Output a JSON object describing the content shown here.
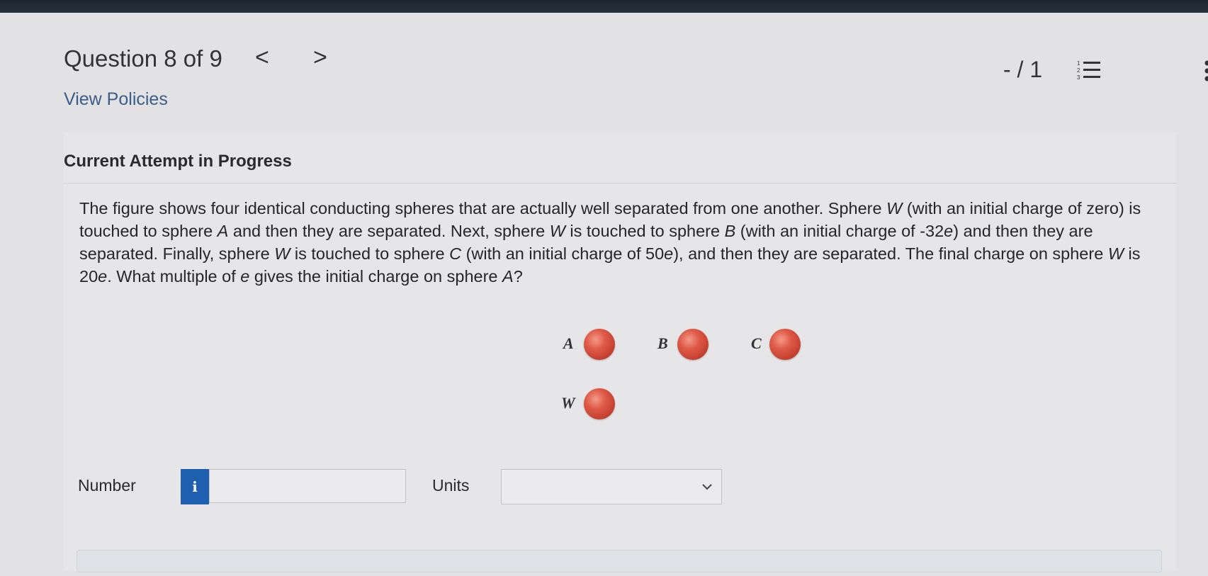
{
  "header": {
    "title": "Question 8 of 9",
    "prev_arrow": "<",
    "next_arrow": ">",
    "score": "- / 1",
    "list_icon": "numbered-list-icon",
    "more_icon": "vertical-ellipsis-icon"
  },
  "policies_link": "View Policies",
  "attempt_heading": "Current Attempt in Progress",
  "question": {
    "parts": [
      {
        "t": "The figure shows four identical conducting spheres that are actually well separated from one another. Sphere ",
        "i": false
      },
      {
        "t": "W",
        "i": true
      },
      {
        "t": " (with an initial charge of zero) is touched to sphere ",
        "i": false
      },
      {
        "t": "A",
        "i": true
      },
      {
        "t": " and then they are separated. Next, sphere ",
        "i": false
      },
      {
        "t": "W",
        "i": true
      },
      {
        "t": " is touched to sphere ",
        "i": false
      },
      {
        "t": "B",
        "i": true
      },
      {
        "t": " (with an initial charge of -32",
        "i": false
      },
      {
        "t": "e",
        "i": true
      },
      {
        "t": ") and then they are separated. Finally, sphere ",
        "i": false
      },
      {
        "t": "W",
        "i": true
      },
      {
        "t": " is touched to sphere ",
        "i": false
      },
      {
        "t": "C",
        "i": true
      },
      {
        "t": " (with an initial charge of 50",
        "i": false
      },
      {
        "t": "e",
        "i": true
      },
      {
        "t": "), and then they are separated. The final charge on sphere ",
        "i": false
      },
      {
        "t": "W",
        "i": true
      },
      {
        "t": " is 20",
        "i": false
      },
      {
        "t": "e",
        "i": true
      },
      {
        "t": ". What multiple of ",
        "i": false
      },
      {
        "t": "e",
        "i": true
      },
      {
        "t": " gives the initial charge on sphere ",
        "i": false
      },
      {
        "t": "A",
        "i": true
      },
      {
        "t": "?",
        "i": false
      }
    ]
  },
  "figure": {
    "labels": {
      "a": "A",
      "b": "B",
      "c": "C",
      "w": "W"
    },
    "sphere_color": "#cf4a38"
  },
  "answer": {
    "number_label": "Number",
    "info_icon": "i",
    "number_value": "",
    "units_label": "Units",
    "units_value": ""
  },
  "colors": {
    "link": "#3d5d87",
    "info_badge": "#1f5fb0"
  }
}
